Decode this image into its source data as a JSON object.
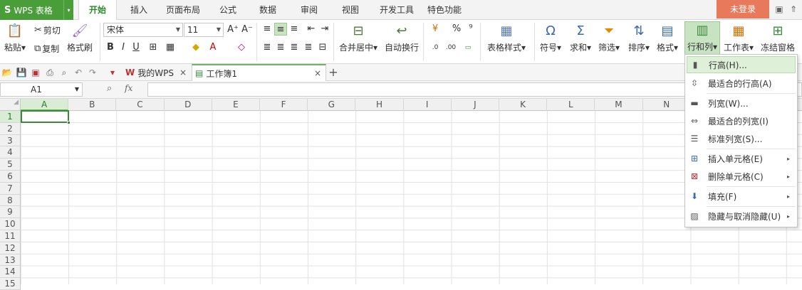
{
  "app": {
    "logo": "S",
    "name": "WPS 表格",
    "drop": "▾"
  },
  "menubar": {
    "tabs": [
      "开始",
      "插入",
      "页面布局",
      "公式",
      "数据",
      "审阅",
      "视图",
      "开发工具",
      "特色功能"
    ],
    "login": "未登录"
  },
  "ribbon": {
    "paste": "粘贴▾",
    "cut": "剪切",
    "copy": "复制",
    "format_painter": "格式刷",
    "font_name": "宋体",
    "font_size": "11",
    "merge_center": "合并居中▾",
    "wrap_text": "自动换行",
    "percent": "%",
    "comma": "⁹",
    "table_style": "表格样式▾",
    "symbol": "符号▾",
    "sum": "求和▾",
    "filter": "筛选▾",
    "sort": "排序▾",
    "format": "格式▾",
    "row_col": "行和列▾",
    "worksheet": "工作表▾",
    "freeze": "冻结窗格"
  },
  "doc_tabs": {
    "my_wps": "我的WPS",
    "workbook": "工作簿1",
    "add": "+"
  },
  "formula_bar": {
    "cell_ref": "A1",
    "fx": "fx"
  },
  "columns": [
    "A",
    "B",
    "C",
    "D",
    "E",
    "F",
    "G",
    "H",
    "I",
    "J",
    "K",
    "L",
    "M",
    "N"
  ],
  "rows": [
    "1",
    "2",
    "3",
    "4",
    "5",
    "6",
    "7",
    "8",
    "9",
    "10",
    "11",
    "12",
    "13",
    "14",
    "15"
  ],
  "menu": {
    "items": [
      {
        "label": "行高(H)...",
        "icon": "row-height-icon"
      },
      {
        "label": "最适合的行高(A)",
        "icon": "autofit-row-icon"
      },
      {
        "label": "列宽(W)...",
        "icon": "col-width-icon"
      },
      {
        "label": "最适合的列宽(I)",
        "icon": "autofit-col-icon"
      },
      {
        "label": "标准列宽(S)...",
        "icon": "standard-width-icon"
      },
      {
        "label": "插入单元格(E)",
        "icon": "insert-cells-icon"
      },
      {
        "label": "删除单元格(C)",
        "icon": "delete-cells-icon"
      },
      {
        "label": "填充(F)",
        "icon": "fill-icon"
      },
      {
        "label": "隐藏与取消隐藏(U)",
        "icon": "hide-unhide-icon"
      }
    ],
    "submenu_arrow": "▸"
  },
  "colors": {
    "accent": "#4a9e3a",
    "login": "#e8795a",
    "highlight": "#dff0d8"
  }
}
